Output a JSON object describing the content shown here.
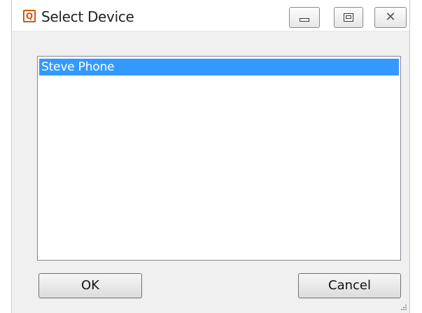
{
  "window": {
    "title": "Select Device",
    "icon": "app-q-icon",
    "icon_letter": "Q"
  },
  "caption_buttons": {
    "minimize_icon": "minimize-icon",
    "maximize_icon": "maximize-icon",
    "close_icon": "close-icon",
    "close_glyph": "✕"
  },
  "device_list": {
    "items": [
      {
        "label": "Steve Phone",
        "selected": true
      }
    ]
  },
  "buttons": {
    "ok_label": "OK",
    "cancel_label": "Cancel"
  },
  "colors": {
    "selection": "#3399ff",
    "dialog_background": "#f0f0f0",
    "app_icon": "#e26a1a"
  }
}
